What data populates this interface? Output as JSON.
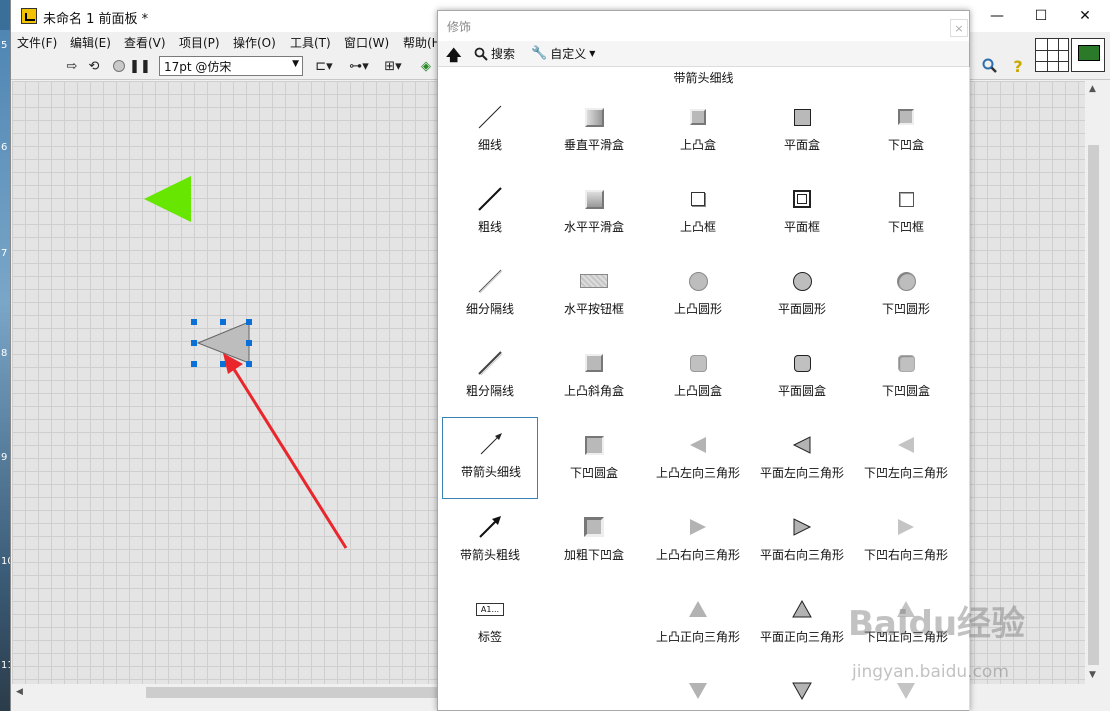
{
  "window": {
    "title": "未命名 1 前面板 *",
    "minimize": "—",
    "maximize": "☐",
    "close": "✕"
  },
  "menu": [
    "文件(F)",
    "编辑(E)",
    "查看(V)",
    "项目(P)",
    "操作(O)",
    "工具(T)",
    "窗口(W)",
    "帮助(H)"
  ],
  "toolbar": {
    "font_value": "17pt @仿宋",
    "search_icon": "search-icon",
    "help_label": "?"
  },
  "desktop_edge_digits": [
    "5",
    "6",
    "7",
    "8",
    "9",
    "10",
    "11"
  ],
  "palette": {
    "title": "修饰",
    "close": "×",
    "tools": {
      "search": "搜索",
      "customize": "自定义"
    },
    "hover_label": "带箭头细线",
    "items": [
      "细线",
      "垂直平滑盒",
      "上凸盒",
      "平面盒",
      "下凹盒",
      "粗线",
      "水平平滑盒",
      "上凸框",
      "平面框",
      "下凹框",
      "细分隔线",
      "水平按钮框",
      "上凸圆形",
      "平面圆形",
      "下凹圆形",
      "粗分隔线",
      "上凸斜角盒",
      "上凸圆盒",
      "平面圆盒",
      "下凹圆盒",
      "带箭头细线",
      "下凹圆盒",
      "上凸左向三角形",
      "平面左向三角形",
      "下凹左向三角形",
      "带箭头粗线",
      "加粗下凹盒",
      "上凸右向三角形",
      "平面右向三角形",
      "下凹右向三角形",
      "标签",
      "",
      "上凸正向三角形",
      "平面正向三角形",
      "下凹正向三角形"
    ],
    "label_icon_text": "A1..."
  },
  "colors": {
    "green_triangle": "#66e600",
    "annotation_arrow": "#e8262c",
    "selection_handle": "#0a6fd6"
  },
  "watermark": {
    "brand": "Baidu经验",
    "url": "jingyan.baidu.com"
  }
}
